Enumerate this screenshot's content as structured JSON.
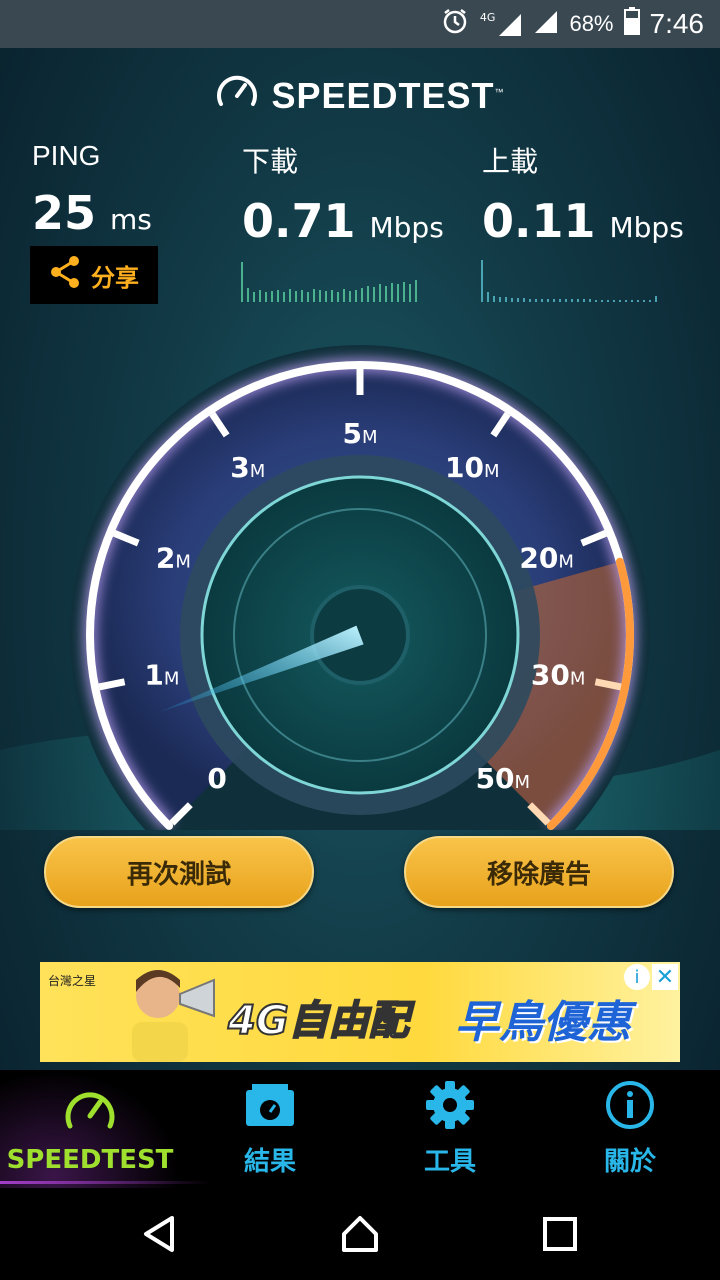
{
  "status_bar": {
    "network": "4G",
    "battery_percent": "68%",
    "time": "7:46"
  },
  "header": {
    "title": "SPEEDTEST",
    "trademark": "™"
  },
  "metrics": {
    "ping": {
      "label": "PING",
      "value": "25",
      "unit": "ms"
    },
    "download": {
      "label": "下載",
      "value": "0.71",
      "unit": "Mbps"
    },
    "upload": {
      "label": "上載",
      "value": "0.11",
      "unit": "Mbps"
    }
  },
  "share": {
    "label": "分享"
  },
  "gauge": {
    "tick_labels": [
      {
        "num": "0",
        "unit": ""
      },
      {
        "num": "1",
        "unit": "M"
      },
      {
        "num": "2",
        "unit": "M"
      },
      {
        "num": "3",
        "unit": "M"
      },
      {
        "num": "5",
        "unit": "M"
      },
      {
        "num": "10",
        "unit": "M"
      },
      {
        "num": "20",
        "unit": "M"
      },
      {
        "num": "30",
        "unit": "M"
      },
      {
        "num": "50",
        "unit": "M"
      }
    ],
    "needle_value_mbps": 0.71
  },
  "buttons": {
    "retest": "再次測試",
    "remove_ads": "移除廣告"
  },
  "ad": {
    "brand": "台灣之星",
    "slogan_part1": "4G自由配",
    "slogan_part2": "早鳥優惠",
    "info_icon": "i",
    "close_icon": "✕"
  },
  "tabs": [
    {
      "label": "SPEEDTEST",
      "icon": "speedometer-icon",
      "active": true
    },
    {
      "label": "結果",
      "icon": "results-folder-icon",
      "active": false
    },
    {
      "label": "工具",
      "icon": "gear-icon",
      "active": false
    },
    {
      "label": "關於",
      "icon": "info-icon",
      "active": false
    }
  ],
  "colors": {
    "accent_green": "#9ee02d",
    "accent_blue": "#29b6e8",
    "button_gold": "#f2b22e",
    "share_orange": "#ffb01e"
  }
}
